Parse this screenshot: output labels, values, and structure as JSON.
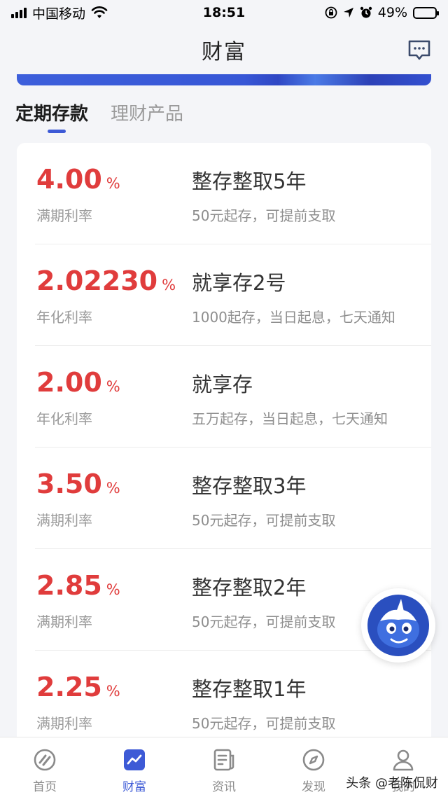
{
  "status_bar": {
    "carrier": "中国移动",
    "time": "18:51",
    "battery": "49%",
    "battery_level": 0.49
  },
  "header": {
    "title": "财富"
  },
  "tabs": [
    {
      "label": "定期存款",
      "active": true
    },
    {
      "label": "理财产品",
      "active": false
    }
  ],
  "products": [
    {
      "rate": "4.00",
      "unit": "%",
      "rate_label": "满期利率",
      "name": "整存整取5年",
      "desc": "50元起存，可提前支取"
    },
    {
      "rate": "2.02230",
      "unit": "%",
      "rate_label": "年化利率",
      "name": "就享存2号",
      "desc": "1000起存，当日起息，七天通知"
    },
    {
      "rate": "2.00",
      "unit": "%",
      "rate_label": "年化利率",
      "name": "就享存",
      "desc": "五万起存，当日起息，七天通知"
    },
    {
      "rate": "3.50",
      "unit": "%",
      "rate_label": "满期利率",
      "name": "整存整取3年",
      "desc": "50元起存，可提前支取"
    },
    {
      "rate": "2.85",
      "unit": "%",
      "rate_label": "满期利率",
      "name": "整存整取2年",
      "desc": "50元起存，可提前支取"
    },
    {
      "rate": "2.25",
      "unit": "%",
      "rate_label": "满期利率",
      "name": "整存整取1年",
      "desc": "50元起存，可提前支取"
    }
  ],
  "bottom_nav": [
    {
      "label": "首页",
      "icon": "home-icon",
      "active": false
    },
    {
      "label": "财富",
      "icon": "wealth-chart-icon",
      "active": true
    },
    {
      "label": "资讯",
      "icon": "news-icon",
      "active": false
    },
    {
      "label": "发现",
      "icon": "compass-icon",
      "active": false
    },
    {
      "label": "我的",
      "icon": "profile-icon",
      "active": false
    }
  ],
  "watermark": "头条 @老陈侃财",
  "colors": {
    "accent": "#3d5ad6",
    "rate_red": "#e03c3c",
    "background": "#f4f5f8"
  }
}
